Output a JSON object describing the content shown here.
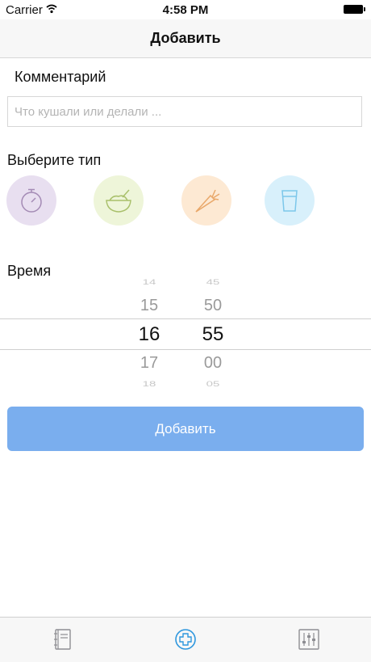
{
  "status_bar": {
    "carrier": "Carrier",
    "time": "4:58 PM"
  },
  "nav": {
    "title": "Добавить"
  },
  "comment": {
    "label": "Комментарий",
    "placeholder": "Что кушали или делали ..."
  },
  "type_section": {
    "label": "Выберите тип",
    "types": [
      {
        "icon": "stopwatch-icon",
        "color": "#e8dff0"
      },
      {
        "icon": "bowl-icon",
        "color": "#eef5d9"
      },
      {
        "icon": "carrot-icon",
        "color": "#fde9d3"
      },
      {
        "icon": "glass-icon",
        "color": "#d8f0fb"
      }
    ]
  },
  "time_section": {
    "label": "Время",
    "hours": [
      "14",
      "15",
      "16",
      "17",
      "18"
    ],
    "minutes": [
      "45",
      "50",
      "55",
      "00",
      "05"
    ],
    "selected_hour": "16",
    "selected_minute": "55"
  },
  "add_button": {
    "label": "Добавить",
    "color": "#7aaeee"
  },
  "tab_bar": {
    "tabs": [
      {
        "icon": "notebook-icon",
        "selected": false
      },
      {
        "icon": "add-circle-icon",
        "selected": true
      },
      {
        "icon": "settings-sliders-icon",
        "selected": false
      }
    ],
    "accent": "#2e97de"
  }
}
